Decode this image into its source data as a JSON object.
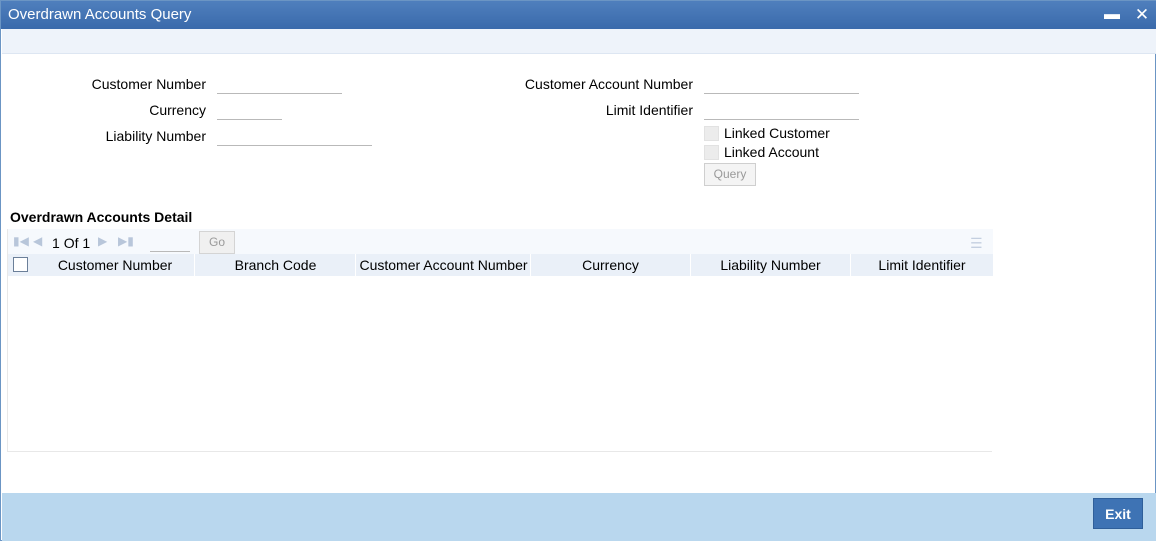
{
  "window": {
    "title": "Overdrawn Accounts Query",
    "minimize_glyph": "▬",
    "close_glyph": "✕"
  },
  "form": {
    "customer_number_label": "Customer Number",
    "currency_label": "Currency",
    "liability_number_label": "Liability Number",
    "customer_account_number_label": "Customer Account Number",
    "limit_identifier_label": "Limit Identifier",
    "linked_customer_label": "Linked Customer",
    "linked_account_label": "Linked Account",
    "query_button": "Query",
    "customer_number_value": "",
    "currency_value": "",
    "liability_number_value": "",
    "customer_account_number_value": "",
    "limit_identifier_value": ""
  },
  "detail": {
    "section_title": "Overdrawn Accounts Detail",
    "pager": {
      "current_page": "1",
      "of_label": "Of",
      "total_pages": "1",
      "go_button": "Go"
    },
    "columns": [
      "Customer Number",
      "Branch Code",
      "Customer Account Number",
      "Currency",
      "Liability Number",
      "Limit Identifier"
    ],
    "rows": []
  },
  "footer": {
    "exit_button": "Exit"
  },
  "colors": {
    "titlebar": "#3a6aab",
    "footer": "#b9d7ee",
    "exit_button": "#3e73b4",
    "grid_header": "#eaf0f8"
  }
}
